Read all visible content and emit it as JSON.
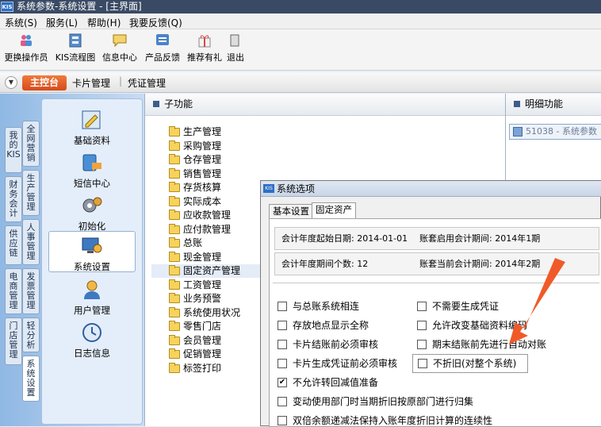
{
  "window": {
    "title": "系统参数-系统设置 - [主界面]",
    "logo": "KIS"
  },
  "menu": [
    "系统(S)",
    "服务(L)",
    "帮助(H)",
    "我要反馈(Q)"
  ],
  "toolbar": [
    "更换操作员",
    "KIS流程图",
    "信息中心",
    "产品反馈",
    "推荐有礼",
    "退出"
  ],
  "tabs": {
    "main": "主控台",
    "card": "卡片管理",
    "voucher": "凭证管理"
  },
  "vtabs": [
    "我的KIS",
    "全网营销",
    "财务会计",
    "生产管理",
    "供应链",
    "人事管理",
    "电商管理",
    "发票管理",
    "门店管理",
    "轻分析",
    "系统设置"
  ],
  "modules": [
    "基础资料",
    "短信中心",
    "初始化",
    "系统设置",
    "用户管理",
    "日志信息"
  ],
  "subfunc": {
    "header": "子功能",
    "items": [
      "生产管理",
      "采购管理",
      "仓存管理",
      "销售管理",
      "存货核算",
      "实际成本",
      "应收款管理",
      "应付款管理",
      "总账",
      "现金管理",
      "固定资产管理",
      "工资管理",
      "业务预警",
      "系统使用状况",
      "零售门店",
      "会员管理",
      "促销管理",
      "标签打印"
    ]
  },
  "detail": {
    "header": "明细功能",
    "item": "51038 - 系统参数"
  },
  "dialog": {
    "title": "系统选项",
    "logo": "KIS",
    "tabs": [
      "基本设置",
      "固定资产"
    ],
    "info": {
      "start_date": "会计年度起始日期: 2014-01-01",
      "start_period": "账套启用会计期间: 2014年1期",
      "periods": "会计年度期间个数: 12",
      "current_period": "账套当前会计期间: 2014年2期"
    },
    "options_left": [
      {
        "label": "与总账系统相连",
        "checked": false
      },
      {
        "label": "存放地点显示全称",
        "checked": false
      },
      {
        "label": "卡片结账前必须审核",
        "checked": false
      },
      {
        "label": "卡片生成凭证前必须审核",
        "checked": false
      },
      {
        "label": "不允许转回减值准备",
        "checked": true
      },
      {
        "label": "变动使用部门时当期折旧按原部门进行归集",
        "checked": false
      },
      {
        "label": "双倍余额递减法保持入账年度折旧计算的连续性",
        "checked": false
      }
    ],
    "options_right": [
      {
        "label": "不需要生成凭证",
        "checked": false
      },
      {
        "label": "允许改变基础资料编码",
        "checked": false
      },
      {
        "label": "期末结账前先进行自动对账",
        "checked": false
      },
      {
        "label": "不折旧(对整个系统)",
        "checked": false
      }
    ]
  },
  "colors": {
    "accent_tab": "#e0572a",
    "annotation": "#f05a28"
  }
}
